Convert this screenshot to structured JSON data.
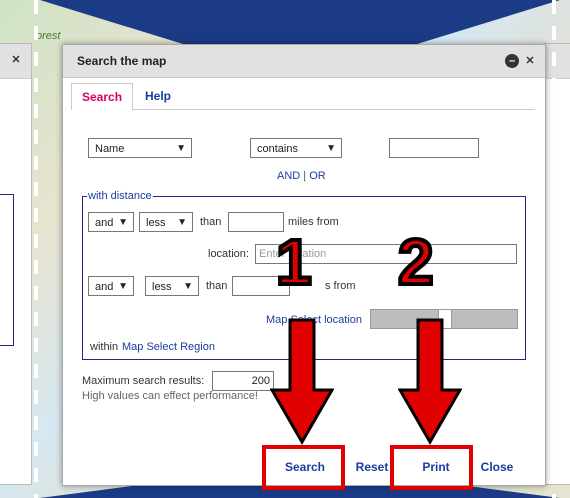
{
  "background": {
    "forest_label": "orest"
  },
  "dialog": {
    "title": "Search the map",
    "minimize_icon": "minus-circle-icon",
    "close_icon": "close-icon"
  },
  "tabs": [
    {
      "label": "Search"
    },
    {
      "label": "Help"
    }
  ],
  "criteria": {
    "field_select": "Name",
    "operator_select": "contains",
    "and_or": {
      "and": "AND",
      "sep": " | ",
      "or": "OR"
    }
  },
  "distance": {
    "legend": "with distance",
    "row1": {
      "conj": "and",
      "cmp": "less",
      "than": "than",
      "miles_from": "miles from"
    },
    "location_label": "location:",
    "location_placeholder": "Enter location",
    "row2": {
      "conj": "and",
      "cmp": "less",
      "than": "than",
      "miles_from": "s from"
    },
    "map_select_location": "Map Select location",
    "within": "within",
    "map_select_region": "Map Select Region"
  },
  "max_results": {
    "label": "Maximum search results:",
    "value": "200",
    "note": "High values can effect performance!"
  },
  "buttons": {
    "search": "Search",
    "reset": "Reset",
    "print": "Print",
    "close": "Close"
  },
  "annotations": {
    "step1": "1",
    "step2": "2"
  },
  "colors": {
    "highlight": "#e00000",
    "link": "#1a3c9e",
    "active_tab": "#d6006a",
    "banner": "#1b3b86"
  }
}
